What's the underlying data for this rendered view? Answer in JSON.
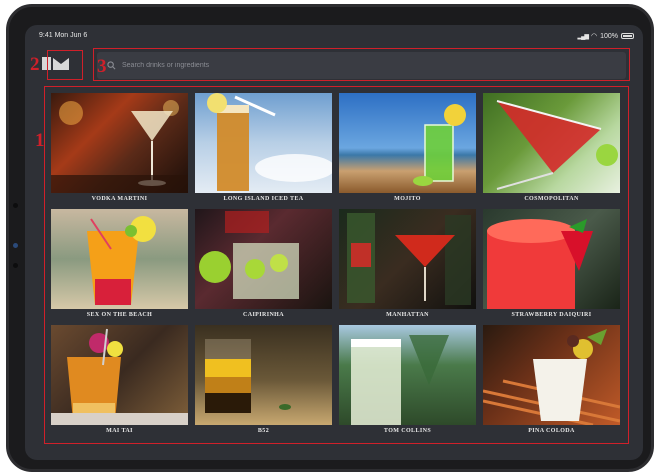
{
  "status_bar": {
    "time": "9:41",
    "date": "Mon Jun 6",
    "battery": "100%"
  },
  "search": {
    "placeholder": "Search drinks or ingredients",
    "icon": "search-icon"
  },
  "logo": {
    "icon": "bar-logo-icon"
  },
  "annotations": [
    "1",
    "2",
    "3"
  ],
  "accent_color": "#d0202a",
  "drinks": [
    {
      "name": "VODKA MARTINI"
    },
    {
      "name": "LONG ISLAND ICED TEA"
    },
    {
      "name": "MOJITO"
    },
    {
      "name": "COSMOPOLITAN"
    },
    {
      "name": "SEX ON THE BEACH"
    },
    {
      "name": "CAIPIRINHA"
    },
    {
      "name": "MANHATTAN"
    },
    {
      "name": "STRAWBERRY DAIQUIRI"
    },
    {
      "name": "MAI TAI"
    },
    {
      "name": "B52"
    },
    {
      "name": "TOM COLLINS"
    },
    {
      "name": "PINA COLODA"
    }
  ]
}
